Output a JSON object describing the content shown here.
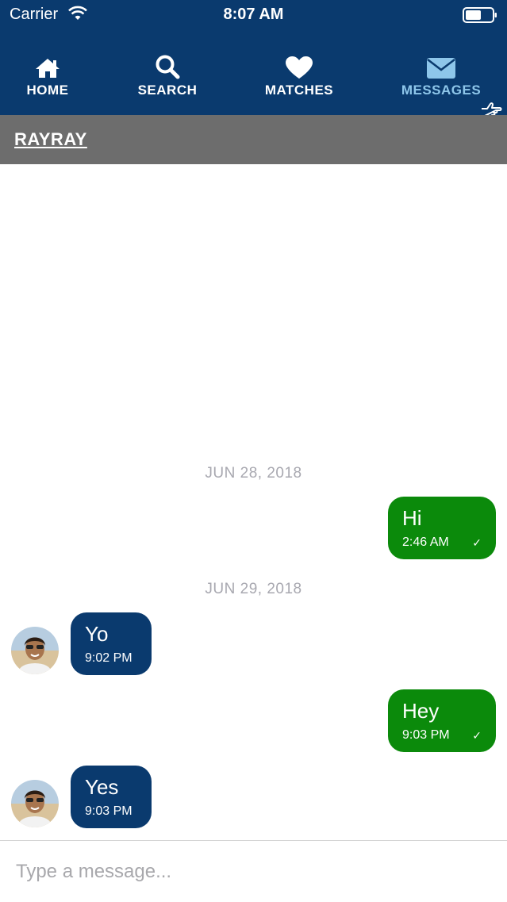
{
  "status_bar": {
    "carrier": "Carrier",
    "time": "8:07 AM"
  },
  "nav": {
    "items": [
      {
        "label": "HOME",
        "icon": "home-icon"
      },
      {
        "label": "SEARCH",
        "icon": "search-icon"
      },
      {
        "label": "MATCHES",
        "icon": "heart-icon"
      },
      {
        "label": "MESSAGES",
        "icon": "envelope-icon",
        "active": true
      }
    ]
  },
  "conversation": {
    "contact_name": "RAYRAY",
    "date_1": "JUN 28, 2018",
    "date_2": "JUN 29, 2018",
    "messages": [
      {
        "direction": "sent",
        "text": "Hi",
        "time": "2:46 AM",
        "check": "✓"
      },
      {
        "direction": "received",
        "text": "Yo",
        "time": "9:02 PM"
      },
      {
        "direction": "sent",
        "text": "Hey",
        "time": "9:03 PM",
        "check": "✓"
      },
      {
        "direction": "received",
        "text": "Yes",
        "time": "9:03 PM"
      }
    ]
  },
  "composer": {
    "placeholder": "Type a message..."
  },
  "colors": {
    "header": "#0a3a6e",
    "name_bar": "#6d6d6d",
    "sent_bubble": "#0b8a0b",
    "received_bubble": "#0a3a6e",
    "active_nav": "#8ec6ea"
  }
}
